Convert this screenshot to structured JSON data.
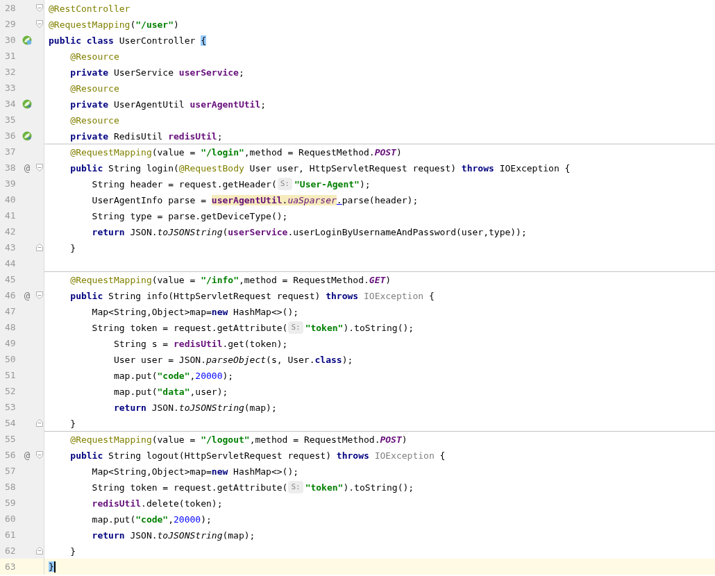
{
  "editor": {
    "lines": [
      {
        "number": "28",
        "current": false,
        "separator_above": false,
        "fold_start": true,
        "fold_end": false,
        "tokens": [
          {
            "kind": "annotation",
            "text": "@RestController"
          }
        ]
      },
      {
        "number": "29",
        "current": false,
        "separator_above": false,
        "fold_start": true,
        "fold_end": false,
        "tokens": [
          {
            "kind": "annotation",
            "text": "@RequestMapping"
          },
          {
            "kind": "plain",
            "text": "("
          },
          {
            "kind": "string",
            "text": "\"/user\""
          },
          {
            "kind": "plain",
            "text": ")"
          }
        ]
      },
      {
        "number": "30",
        "current": false,
        "separator_above": false,
        "fold_start": false,
        "fold_end": false,
        "gutter": {
          "kind": "bean"
        },
        "tokens": [
          {
            "kind": "keyword",
            "text": "public class"
          },
          {
            "kind": "plain",
            "text": " UserController "
          },
          {
            "kind": "brace_match",
            "text": "{"
          }
        ]
      },
      {
        "number": "31",
        "current": false,
        "separator_above": false,
        "fold_start": false,
        "fold_end": false,
        "tokens": [
          {
            "kind": "annotation",
            "text": "    @Resource"
          }
        ]
      },
      {
        "number": "32",
        "current": false,
        "separator_above": false,
        "fold_start": false,
        "fold_end": false,
        "tokens": [
          {
            "kind": "keyword",
            "text": "    private"
          },
          {
            "kind": "plain",
            "text": " UserService "
          },
          {
            "kind": "field",
            "text": "userService"
          },
          {
            "kind": "plain",
            "text": ";"
          }
        ]
      },
      {
        "number": "33",
        "current": false,
        "separator_above": false,
        "fold_start": false,
        "fold_end": false,
        "tokens": [
          {
            "kind": "annotation",
            "text": "    @Resource"
          }
        ]
      },
      {
        "number": "34",
        "current": false,
        "separator_above": false,
        "fold_start": false,
        "fold_end": false,
        "gutter": {
          "kind": "bean_link"
        },
        "tokens": [
          {
            "kind": "keyword",
            "text": "    private"
          },
          {
            "kind": "plain",
            "text": " UserAgentUtil "
          },
          {
            "kind": "field",
            "text": "userAgentUtil"
          },
          {
            "kind": "plain",
            "text": ";"
          }
        ]
      },
      {
        "number": "35",
        "current": false,
        "separator_above": false,
        "fold_start": false,
        "fold_end": false,
        "tokens": [
          {
            "kind": "annotation",
            "text": "    @Resource"
          }
        ]
      },
      {
        "number": "36",
        "current": false,
        "separator_above": false,
        "fold_start": false,
        "fold_end": false,
        "gutter": {
          "kind": "bean_link"
        },
        "tokens": [
          {
            "kind": "keyword",
            "text": "    private"
          },
          {
            "kind": "plain",
            "text": " RedisUtil "
          },
          {
            "kind": "field",
            "text": "redisUtil"
          },
          {
            "kind": "plain",
            "text": ";"
          }
        ]
      },
      {
        "number": "37",
        "current": false,
        "separator_above": true,
        "fold_start": false,
        "fold_end": false,
        "tokens": [
          {
            "kind": "annotation",
            "text": "    @RequestMapping"
          },
          {
            "kind": "plain",
            "text": "(value = "
          },
          {
            "kind": "string",
            "text": "\"/login\""
          },
          {
            "kind": "plain",
            "text": ",method = RequestMethod."
          },
          {
            "kind": "constant",
            "text": "POST"
          },
          {
            "kind": "plain",
            "text": ")"
          }
        ]
      },
      {
        "number": "38",
        "current": false,
        "separator_above": false,
        "fold_start": true,
        "fold_end": false,
        "gutter": {
          "kind": "at",
          "text": "@"
        },
        "tokens": [
          {
            "kind": "keyword",
            "text": "    public"
          },
          {
            "kind": "plain",
            "text": " String login("
          },
          {
            "kind": "annotation",
            "text": "@RequestBody"
          },
          {
            "kind": "plain",
            "text": " User user, HttpServletRequest request) "
          },
          {
            "kind": "keyword",
            "text": "throws"
          },
          {
            "kind": "plain",
            "text": " IOException {"
          }
        ]
      },
      {
        "number": "39",
        "current": false,
        "separator_above": false,
        "fold_start": false,
        "fold_end": false,
        "tokens": [
          {
            "kind": "plain",
            "text": "        String header = request.getHeader("
          },
          {
            "kind": "hint",
            "text": "S:"
          },
          {
            "kind": "string",
            "text": "\"User-Agent\""
          },
          {
            "kind": "plain",
            "text": ");"
          }
        ]
      },
      {
        "number": "40",
        "current": false,
        "separator_above": false,
        "fold_start": false,
        "fold_end": false,
        "tokens": [
          {
            "kind": "plain",
            "text": "        UserAgentInfo parse = "
          },
          {
            "kind": "usage_field",
            "text": "userAgentUtil"
          },
          {
            "kind": "usage_plain",
            "text": "."
          },
          {
            "kind": "usage_static_field",
            "text": "uaSparser"
          },
          {
            "kind": "link_dot",
            "text": "."
          },
          {
            "kind": "plain",
            "text": "parse(header);"
          }
        ]
      },
      {
        "number": "41",
        "current": false,
        "separator_above": false,
        "fold_start": false,
        "fold_end": false,
        "tokens": [
          {
            "kind": "plain",
            "text": "        String type = parse.getDeviceType();"
          }
        ]
      },
      {
        "number": "42",
        "current": false,
        "separator_above": false,
        "fold_start": false,
        "fold_end": false,
        "tokens": [
          {
            "kind": "keyword",
            "text": "        return"
          },
          {
            "kind": "plain",
            "text": " JSON."
          },
          {
            "kind": "static_call",
            "text": "toJSONString"
          },
          {
            "kind": "plain",
            "text": "("
          },
          {
            "kind": "field",
            "text": "userService"
          },
          {
            "kind": "plain",
            "text": ".userLoginByUsernameAndPassword(user,type));"
          }
        ]
      },
      {
        "number": "43",
        "current": false,
        "separator_above": false,
        "fold_start": false,
        "fold_end": true,
        "tokens": [
          {
            "kind": "plain",
            "text": "    }"
          }
        ]
      },
      {
        "number": "44",
        "current": false,
        "separator_above": false,
        "fold_start": false,
        "fold_end": false
      },
      {
        "number": "45",
        "current": false,
        "separator_above": true,
        "fold_start": false,
        "fold_end": false,
        "tokens": [
          {
            "kind": "annotation",
            "text": "    @RequestMapping"
          },
          {
            "kind": "plain",
            "text": "(value = "
          },
          {
            "kind": "string",
            "text": "\"/info\""
          },
          {
            "kind": "plain",
            "text": ",method = RequestMethod."
          },
          {
            "kind": "constant",
            "text": "GET"
          },
          {
            "kind": "plain",
            "text": ")"
          }
        ]
      },
      {
        "number": "46",
        "current": false,
        "separator_above": false,
        "fold_start": true,
        "fold_end": false,
        "gutter": {
          "kind": "at",
          "text": "@"
        },
        "tokens": [
          {
            "kind": "keyword",
            "text": "    public"
          },
          {
            "kind": "plain",
            "text": " String info(HttpServletRequest request) "
          },
          {
            "kind": "keyword",
            "text": "throws "
          },
          {
            "kind": "unused",
            "text": "IOException"
          },
          {
            "kind": "plain",
            "text": " {"
          }
        ]
      },
      {
        "number": "47",
        "current": false,
        "separator_above": false,
        "fold_start": false,
        "fold_end": false,
        "tokens": [
          {
            "kind": "plain",
            "text": "        Map<String,Object>map="
          },
          {
            "kind": "keyword",
            "text": "new"
          },
          {
            "kind": "plain",
            "text": " HashMap<>();"
          }
        ]
      },
      {
        "number": "48",
        "current": false,
        "separator_above": false,
        "fold_start": false,
        "fold_end": false,
        "tokens": [
          {
            "kind": "plain",
            "text": "        String token = request.getAttribute("
          },
          {
            "kind": "hint",
            "text": "S:"
          },
          {
            "kind": "string",
            "text": "\"token\""
          },
          {
            "kind": "plain",
            "text": ").toString();"
          }
        ]
      },
      {
        "number": "49",
        "current": false,
        "separator_above": false,
        "fold_start": false,
        "fold_end": false,
        "tokens": [
          {
            "kind": "plain",
            "text": "            String s = "
          },
          {
            "kind": "field",
            "text": "redisUtil"
          },
          {
            "kind": "plain",
            "text": ".get(token);"
          }
        ]
      },
      {
        "number": "50",
        "current": false,
        "separator_above": false,
        "fold_start": false,
        "fold_end": false,
        "tokens": [
          {
            "kind": "plain",
            "text": "            User user = JSON."
          },
          {
            "kind": "static_call",
            "text": "parseObject"
          },
          {
            "kind": "plain",
            "text": "(s, User."
          },
          {
            "kind": "keyword",
            "text": "class"
          },
          {
            "kind": "plain",
            "text": ");"
          }
        ]
      },
      {
        "number": "51",
        "current": false,
        "separator_above": false,
        "fold_start": false,
        "fold_end": false,
        "tokens": [
          {
            "kind": "plain",
            "text": "            map.put("
          },
          {
            "kind": "string",
            "text": "\"code\""
          },
          {
            "kind": "plain",
            "text": ","
          },
          {
            "kind": "number",
            "text": "20000"
          },
          {
            "kind": "plain",
            "text": ");"
          }
        ]
      },
      {
        "number": "52",
        "current": false,
        "separator_above": false,
        "fold_start": false,
        "fold_end": false,
        "tokens": [
          {
            "kind": "plain",
            "text": "            map.put("
          },
          {
            "kind": "string",
            "text": "\"data\""
          },
          {
            "kind": "plain",
            "text": ",user);"
          }
        ]
      },
      {
        "number": "53",
        "current": false,
        "separator_above": false,
        "fold_start": false,
        "fold_end": false,
        "tokens": [
          {
            "kind": "keyword",
            "text": "            return"
          },
          {
            "kind": "plain",
            "text": " JSON."
          },
          {
            "kind": "static_call",
            "text": "toJSONString"
          },
          {
            "kind": "plain",
            "text": "(map);"
          }
        ]
      },
      {
        "number": "54",
        "current": false,
        "separator_above": false,
        "fold_start": false,
        "fold_end": true,
        "tokens": [
          {
            "kind": "plain",
            "text": "    }"
          }
        ]
      },
      {
        "number": "55",
        "current": false,
        "separator_above": true,
        "fold_start": false,
        "fold_end": false,
        "tokens": [
          {
            "kind": "annotation",
            "text": "    @RequestMapping"
          },
          {
            "kind": "plain",
            "text": "(value = "
          },
          {
            "kind": "string",
            "text": "\"/logout\""
          },
          {
            "kind": "plain",
            "text": ",method = RequestMethod."
          },
          {
            "kind": "constant",
            "text": "POST"
          },
          {
            "kind": "plain",
            "text": ")"
          }
        ]
      },
      {
        "number": "56",
        "current": false,
        "separator_above": false,
        "fold_start": true,
        "fold_end": false,
        "gutter": {
          "kind": "at",
          "text": "@"
        },
        "tokens": [
          {
            "kind": "keyword",
            "text": "    public"
          },
          {
            "kind": "plain",
            "text": " String logout(HttpServletRequest request) "
          },
          {
            "kind": "keyword",
            "text": "throws "
          },
          {
            "kind": "unused",
            "text": "IOException"
          },
          {
            "kind": "plain",
            "text": " {"
          }
        ]
      },
      {
        "number": "57",
        "current": false,
        "separator_above": false,
        "fold_start": false,
        "fold_end": false,
        "tokens": [
          {
            "kind": "plain",
            "text": "        Map<String,Object>map="
          },
          {
            "kind": "keyword",
            "text": "new"
          },
          {
            "kind": "plain",
            "text": " HashMap<>();"
          }
        ]
      },
      {
        "number": "58",
        "current": false,
        "separator_above": false,
        "fold_start": false,
        "fold_end": false,
        "tokens": [
          {
            "kind": "plain",
            "text": "        String token = request.getAttribute("
          },
          {
            "kind": "hint",
            "text": "S:"
          },
          {
            "kind": "string",
            "text": "\"token\""
          },
          {
            "kind": "plain",
            "text": ").toString();"
          }
        ]
      },
      {
        "number": "59",
        "current": false,
        "separator_above": false,
        "fold_start": false,
        "fold_end": false,
        "tokens": [
          {
            "kind": "field",
            "text": "        redisUtil"
          },
          {
            "kind": "plain",
            "text": ".delete(token);"
          }
        ]
      },
      {
        "number": "60",
        "current": false,
        "separator_above": false,
        "fold_start": false,
        "fold_end": false,
        "tokens": [
          {
            "kind": "plain",
            "text": "        map.put("
          },
          {
            "kind": "string",
            "text": "\"code\""
          },
          {
            "kind": "plain",
            "text": ","
          },
          {
            "kind": "number",
            "text": "20000"
          },
          {
            "kind": "plain",
            "text": ");"
          }
        ]
      },
      {
        "number": "61",
        "current": false,
        "separator_above": false,
        "fold_start": false,
        "fold_end": false,
        "tokens": [
          {
            "kind": "keyword",
            "text": "        return"
          },
          {
            "kind": "plain",
            "text": " JSON."
          },
          {
            "kind": "static_call",
            "text": "toJSONString"
          },
          {
            "kind": "plain",
            "text": "(map);"
          }
        ]
      },
      {
        "number": "62",
        "current": false,
        "separator_above": false,
        "fold_start": false,
        "fold_end": true,
        "tokens": [
          {
            "kind": "plain",
            "text": "    }"
          }
        ]
      },
      {
        "number": "63",
        "current": true,
        "separator_above": false,
        "fold_start": false,
        "fold_end": false,
        "tokens": [
          {
            "kind": "brace_match",
            "text": "}"
          }
        ]
      }
    ]
  }
}
